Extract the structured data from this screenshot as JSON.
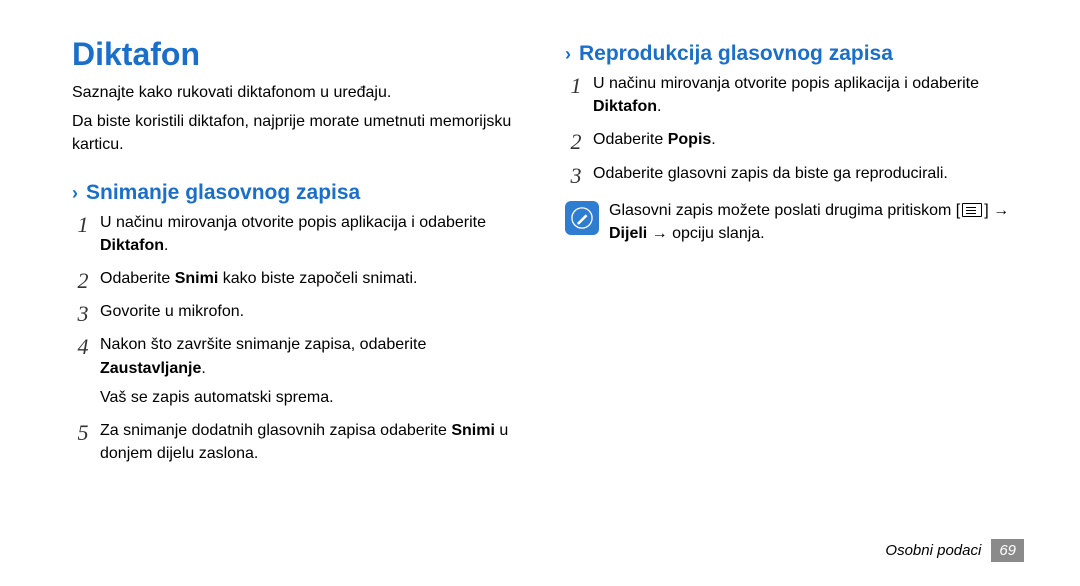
{
  "title": "Diktafon",
  "intro1": "Saznajte kako rukovati diktafonom u uređaju.",
  "intro2": "Da biste koristili diktafon, najprije morate umetnuti memorijsku karticu.",
  "chevron": "›",
  "left": {
    "heading": "Snimanje glasovnog zapisa",
    "step1_a": "U načinu mirovanja otvorite popis aplikacija i odaberite ",
    "step1_b": "Diktafon",
    "step1_c": ".",
    "step2_a": "Odaberite ",
    "step2_b": "Snimi",
    "step2_c": " kako biste započeli snimati.",
    "step3": "Govorite u mikrofon.",
    "step4_a": "Nakon što završite snimanje zapisa, odaberite ",
    "step4_b": "Zaustavljanje",
    "step4_c": ".",
    "step4_sub": "Vaš se zapis automatski sprema.",
    "step5_a": "Za snimanje dodatnih glasovnih zapisa odaberite ",
    "step5_b": "Snimi",
    "step5_c": " u donjem dijelu zaslona."
  },
  "right": {
    "heading": "Reprodukcija glasovnog zapisa",
    "step1_a": "U načinu mirovanja otvorite popis aplikacija i odaberite ",
    "step1_b": "Diktafon",
    "step1_c": ".",
    "step2_a": "Odaberite ",
    "step2_b": "Popis",
    "step2_c": ".",
    "step3": "Odaberite glasovni zapis da biste ga reproducirali.",
    "tip_a": "Glasovni zapis možete poslati drugima pritiskom [",
    "tip_b": "] → ",
    "tip_c": "Dijeli",
    "tip_d": " → opciju slanja."
  },
  "footer": {
    "section": "Osobni podaci",
    "page": "69"
  }
}
